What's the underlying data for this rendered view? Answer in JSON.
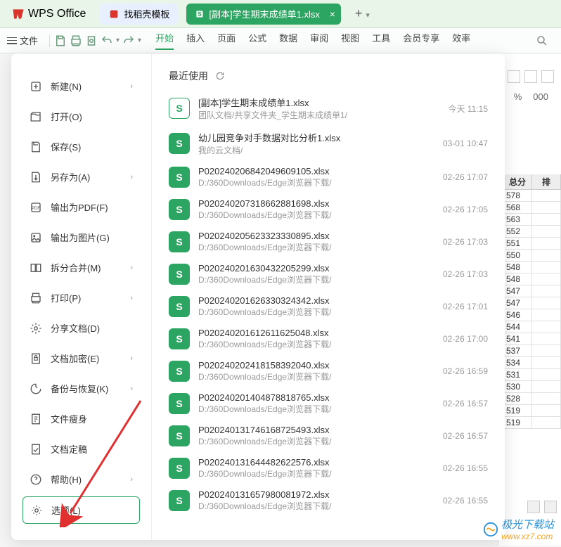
{
  "app": {
    "name": "WPS Office"
  },
  "tabs": {
    "doc_tab": "找稻壳模板",
    "active_tab": "[副本]学生期末成绩单1.xlsx",
    "add": "+"
  },
  "menubar": {
    "file": "文件",
    "items": [
      "开始",
      "插入",
      "页面",
      "公式",
      "数据",
      "审阅",
      "视图",
      "工具",
      "会员专享",
      "效率"
    ]
  },
  "sidebar": [
    {
      "label": "新建(N)",
      "chevron": true
    },
    {
      "label": "打开(O)"
    },
    {
      "label": "保存(S)"
    },
    {
      "label": "另存为(A)",
      "chevron": true
    },
    {
      "label": "输出为PDF(F)"
    },
    {
      "label": "输出为图片(G)"
    },
    {
      "label": "拆分合并(M)",
      "chevron": true
    },
    {
      "label": "打印(P)",
      "chevron": true
    },
    {
      "label": "分享文档(D)"
    },
    {
      "label": "文档加密(E)",
      "chevron": true
    },
    {
      "label": "备份与恢复(K)",
      "chevron": true
    },
    {
      "label": "文件瘦身"
    },
    {
      "label": "文档定稿"
    },
    {
      "label": "帮助(H)",
      "chevron": true
    },
    {
      "label": "选项(L)",
      "selected": true
    }
  ],
  "content": {
    "header": "最近使用",
    "files": [
      {
        "name": "[副本]学生期末成绩单1.xlsx",
        "path": "团队文档/共享文件夹_学生期末成绩单1/",
        "time": "今天 11:15",
        "outline": true
      },
      {
        "name": "幼儿园竞争对手数据对比分析1.xlsx",
        "path": "我的云文档/",
        "time": "03-01 10:47"
      },
      {
        "name": "P020240206842049609105.xlsx",
        "path": "D:/360Downloads/Edge浏览器下载/",
        "time": "02-26 17:07"
      },
      {
        "name": "P020240207318662881698.xlsx",
        "path": "D:/360Downloads/Edge浏览器下载/",
        "time": "02-26 17:05"
      },
      {
        "name": "P020240205623323330895.xlsx",
        "path": "D:/360Downloads/Edge浏览器下载/",
        "time": "02-26 17:03"
      },
      {
        "name": "P020240201630432205299.xlsx",
        "path": "D:/360Downloads/Edge浏览器下载/",
        "time": "02-26 17:03"
      },
      {
        "name": "P020240201626330324342.xlsx",
        "path": "D:/360Downloads/Edge浏览器下载/",
        "time": "02-26 17:01"
      },
      {
        "name": "P020240201612611625048.xlsx",
        "path": "D:/360Downloads/Edge浏览器下载/",
        "time": "02-26 17:00"
      },
      {
        "name": "P020240202418158392040.xlsx",
        "path": "D:/360Downloads/Edge浏览器下载/",
        "time": "02-26 16:59"
      },
      {
        "name": "P020240201404878818765.xlsx",
        "path": "D:/360Downloads/Edge浏览器下载/",
        "time": "02-26 16:57"
      },
      {
        "name": "P020240131746168725493.xlsx",
        "path": "D:/360Downloads/Edge浏览器下载/",
        "time": "02-26 16:57"
      },
      {
        "name": "P020240131644482622576.xlsx",
        "path": "D:/360Downloads/Edge浏览器下载/",
        "time": "02-26 16:55"
      },
      {
        "name": "P020240131657980081972.xlsx",
        "path": "D:/360Downloads/Edge浏览器下载/",
        "time": "02-26 16:55"
      }
    ]
  },
  "bg_sheet": {
    "pct": "%",
    "zeros": "000",
    "header": [
      "总分",
      "排"
    ],
    "cells": [
      "578",
      "568",
      "563",
      "552",
      "551",
      "550",
      "548",
      "548",
      "547",
      "547",
      "546",
      "544",
      "541",
      "537",
      "534",
      "531",
      "530",
      "528",
      "519",
      "519"
    ]
  },
  "watermark": {
    "text": "极光下载站",
    "url": "www.xz7.com"
  }
}
